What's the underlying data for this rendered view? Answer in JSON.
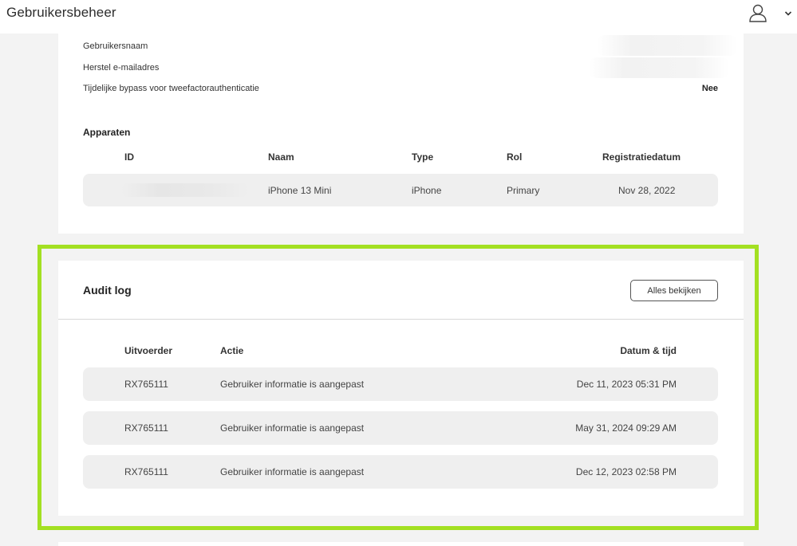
{
  "header": {
    "title": "Gebruikersbeheer",
    "user_icon": "user-icon",
    "chevron_icon": "chevron-down-icon"
  },
  "user_details": {
    "fields": [
      {
        "label": "Gebruikersnaam",
        "value": ""
      },
      {
        "label": "Herstel e-mailadres",
        "value": ""
      },
      {
        "label": "Tijdelijke bypass voor tweefactorauthenticatie",
        "value": "Nee"
      }
    ]
  },
  "devices": {
    "title": "Apparaten",
    "columns": [
      "ID",
      "Naam",
      "Type",
      "Rol",
      "Registratiedatum"
    ],
    "rows": [
      {
        "id": "",
        "name": "iPhone 13 Mini",
        "type": "iPhone",
        "role": "Primary",
        "registered": "Nov 28, 2022"
      }
    ]
  },
  "audit_log": {
    "title": "Audit log",
    "view_all_label": "Alles bekijken",
    "columns": [
      "Uitvoerder",
      "Actie",
      "Datum & tijd"
    ],
    "rows": [
      {
        "actor": "RX765111",
        "action": "Gebruiker informatie is aangepast",
        "datetime": "Dec 11, 2023 05:31 PM"
      },
      {
        "actor": "RX765111",
        "action": "Gebruiker informatie is aangepast",
        "datetime": "May 31, 2024 09:29 AM"
      },
      {
        "actor": "RX765111",
        "action": "Gebruiker informatie is aangepast",
        "datetime": "Dec 12, 2023 02:58 PM"
      }
    ]
  },
  "colors": {
    "highlight": "#a3e022",
    "row_background": "#efefef",
    "page_background": "#f3f3f3"
  }
}
